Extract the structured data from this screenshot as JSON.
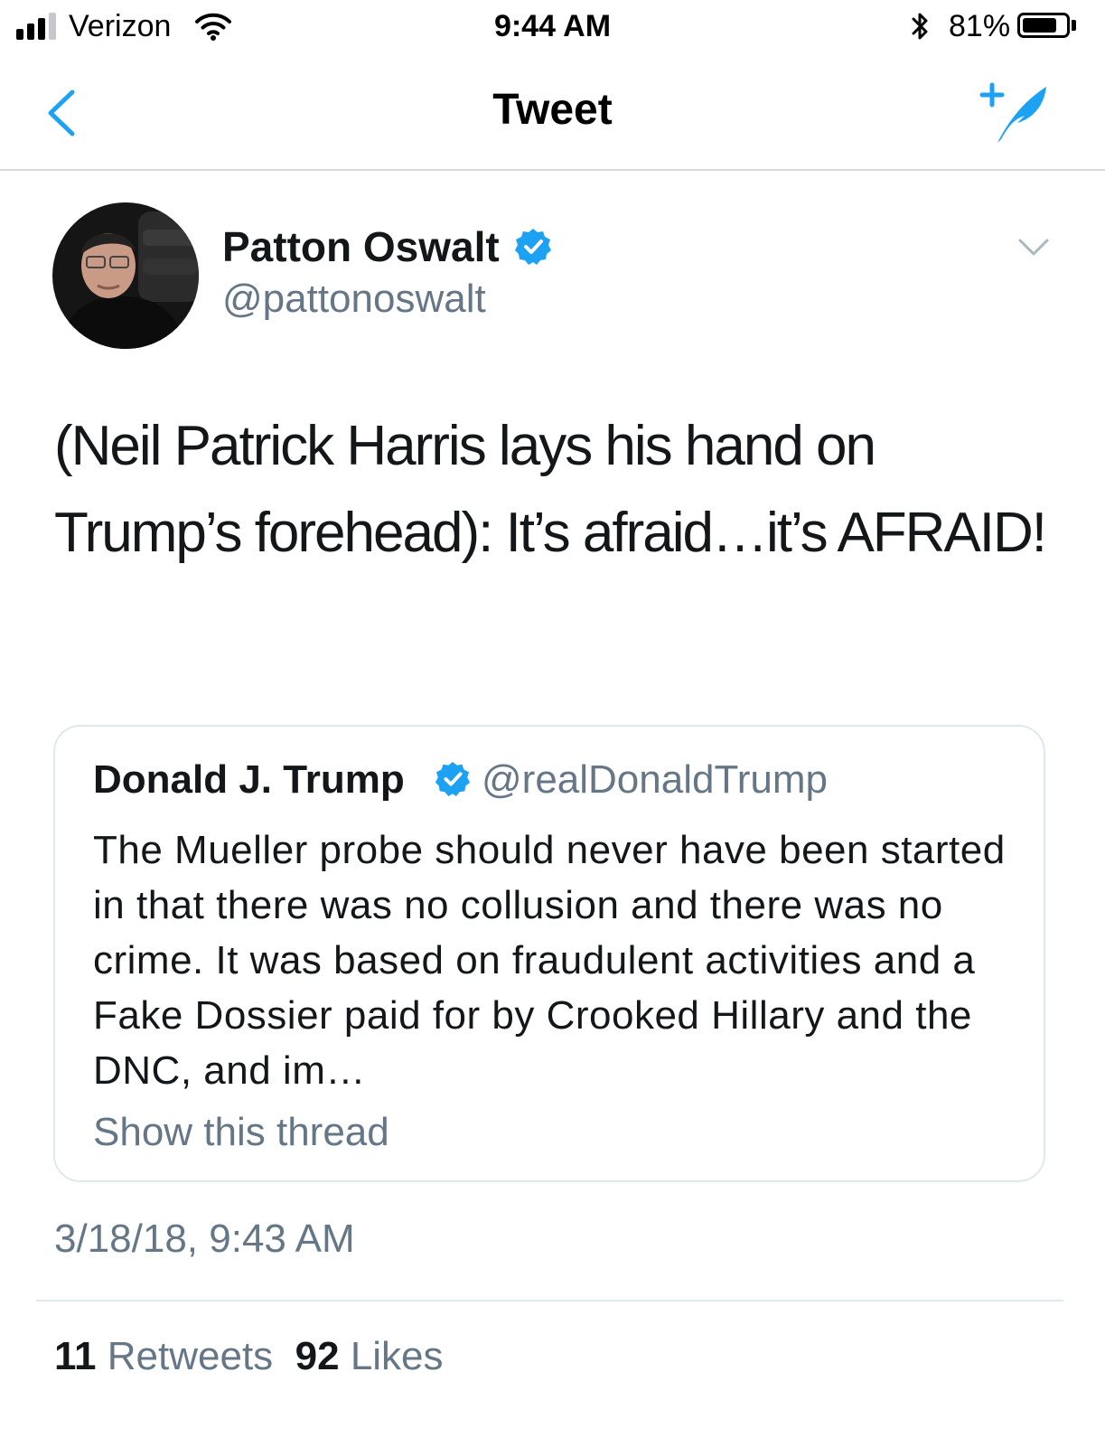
{
  "status_bar": {
    "carrier": "Verizon",
    "time": "9:44 AM",
    "battery_percent": "81%",
    "battery_level": 0.81,
    "signal_bars_filled": 3,
    "signal_bars_total": 4
  },
  "nav": {
    "title": "Tweet",
    "back_icon": "chevron-left-icon",
    "compose_icon": "compose-tweet-icon"
  },
  "tweet": {
    "author_name": "Patton Oswalt",
    "author_handle": "@pattonoswalt",
    "verified": true,
    "text": "(Neil Patrick Harris lays his hand on Trump’s forehead): It’s afraid…it’s AFRAID!",
    "timestamp": "3/18/18, 9:43 AM"
  },
  "quoted_tweet": {
    "author_name": "Donald J. Trump",
    "author_handle": "@realDonaldTrump",
    "verified": true,
    "text": "The Mueller probe should never have been started in that there was no collusion and there was no crime. It was based on fraudulent activities and a Fake Dossier paid for by Crooked Hillary and the DNC, and im…",
    "thread_link": "Show this thread"
  },
  "stats": {
    "retweets_count": "11",
    "retweets_label": "Retweets",
    "likes_count": "92",
    "likes_label": "Likes"
  },
  "colors": {
    "accent": "#1da1f2",
    "text_primary": "#14171a",
    "text_secondary": "#657786",
    "border": "#e1e8ed"
  }
}
